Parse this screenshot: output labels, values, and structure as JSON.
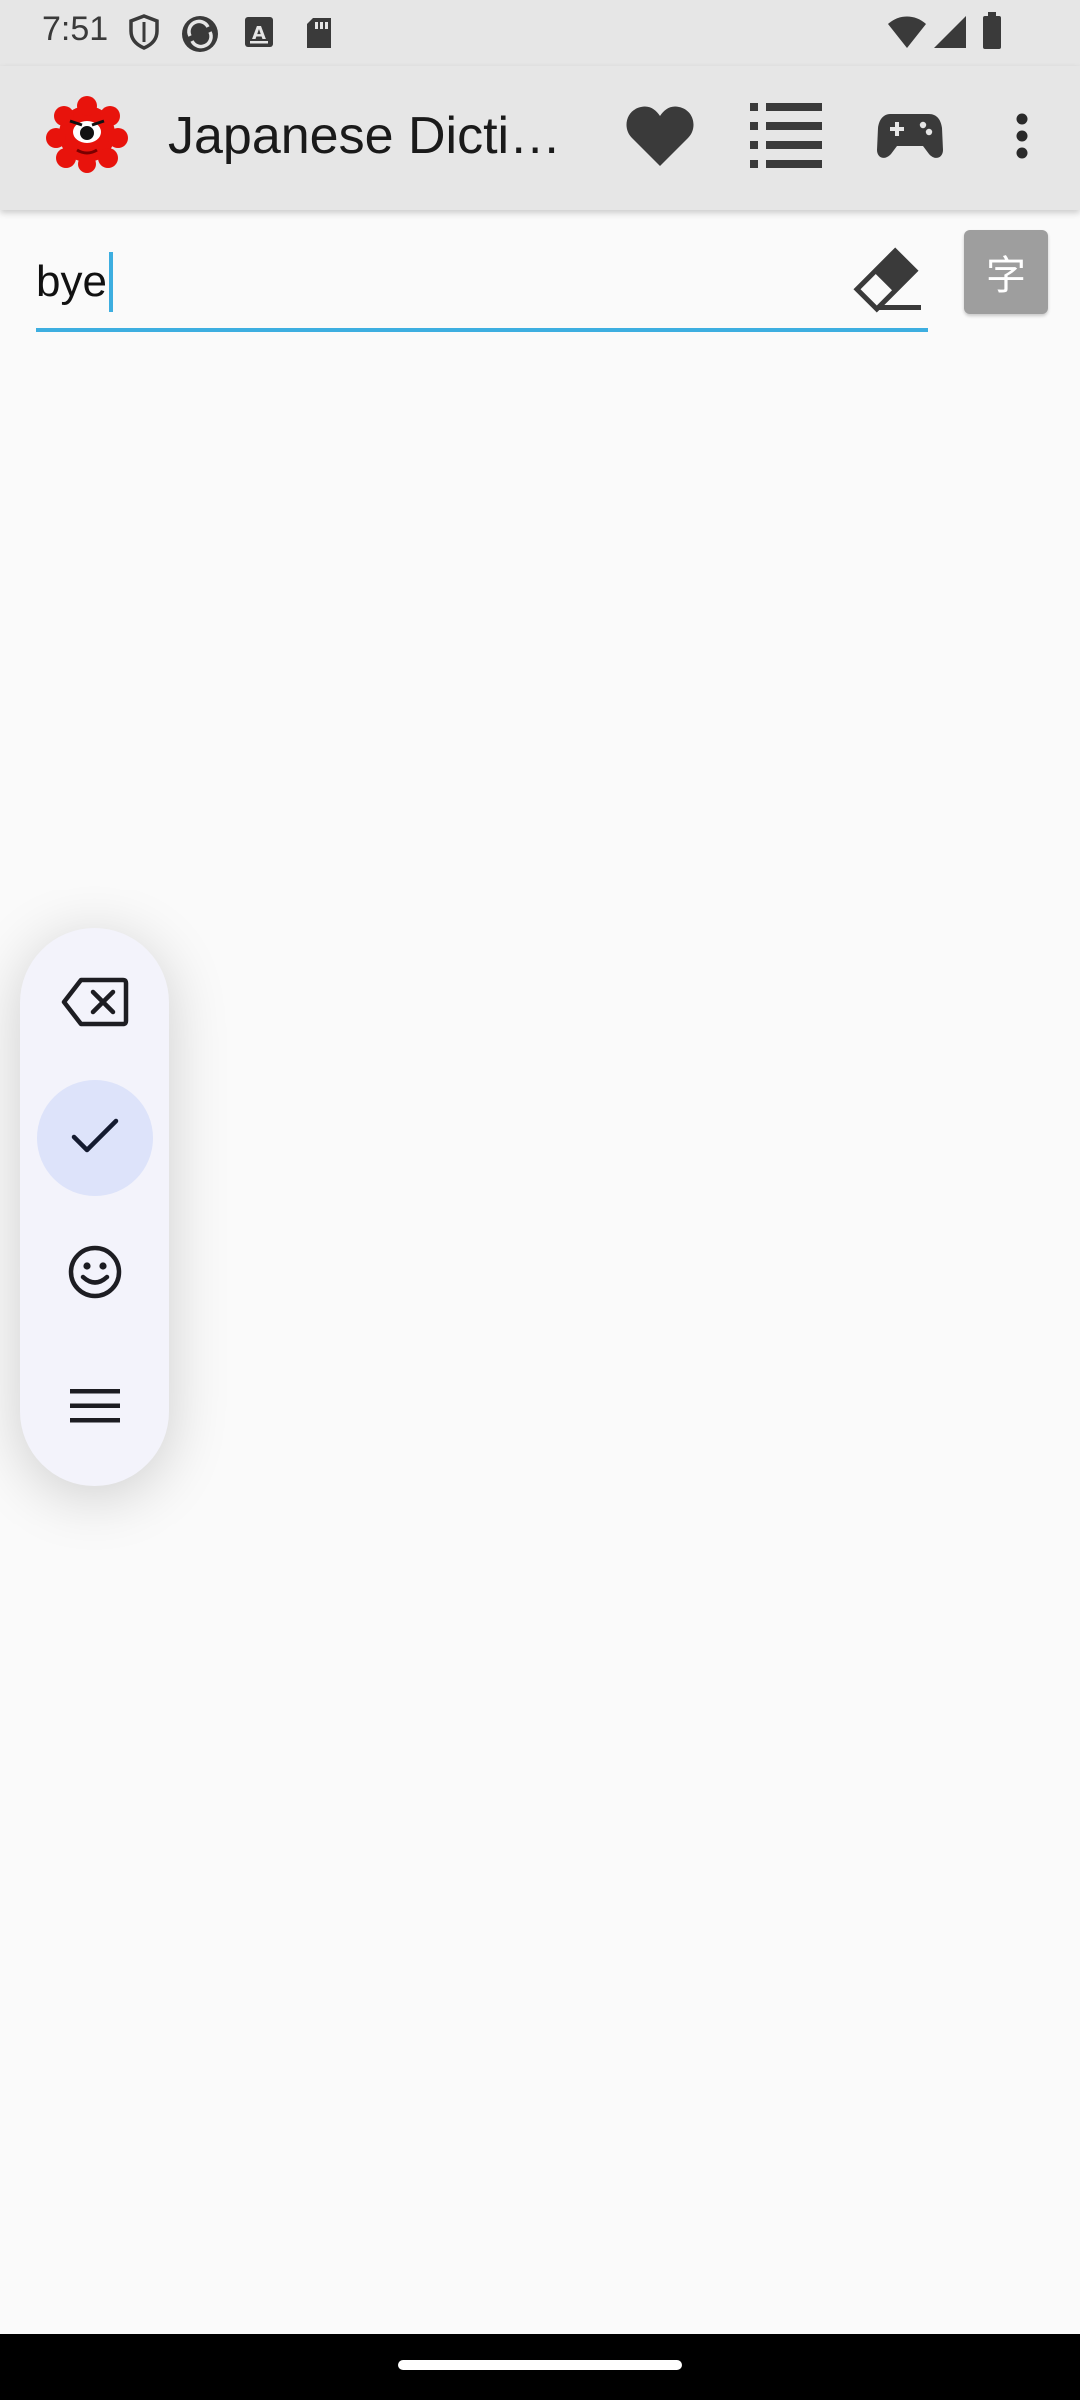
{
  "status_bar": {
    "time": "7:51",
    "icons_left": [
      "shield-icon",
      "sync-icon",
      "font-a-icon",
      "sd-card-icon"
    ],
    "icons_right": [
      "wifi-icon",
      "signal-icon",
      "battery-icon"
    ]
  },
  "app_bar": {
    "title": "Japanese Dictionary",
    "logo": "red-monster-logo",
    "actions": [
      "favorites-heart-icon",
      "list-icon",
      "gamepad-icon",
      "more-vert-icon"
    ]
  },
  "search": {
    "value": "bye",
    "clear_icon": "eraser-icon",
    "kanji_button_label": "字"
  },
  "keyboard_toolbar": {
    "items": [
      "backspace-icon",
      "check-icon",
      "emoji-icon",
      "menu-icon"
    ],
    "active_index": 1
  },
  "colors": {
    "accent": "#3daee0",
    "app_bar_bg": "#e6e6e6",
    "logo_red": "#e8130c",
    "toolbar_bg": "#f3f3fb",
    "toolbar_active": "#dde3fa"
  }
}
